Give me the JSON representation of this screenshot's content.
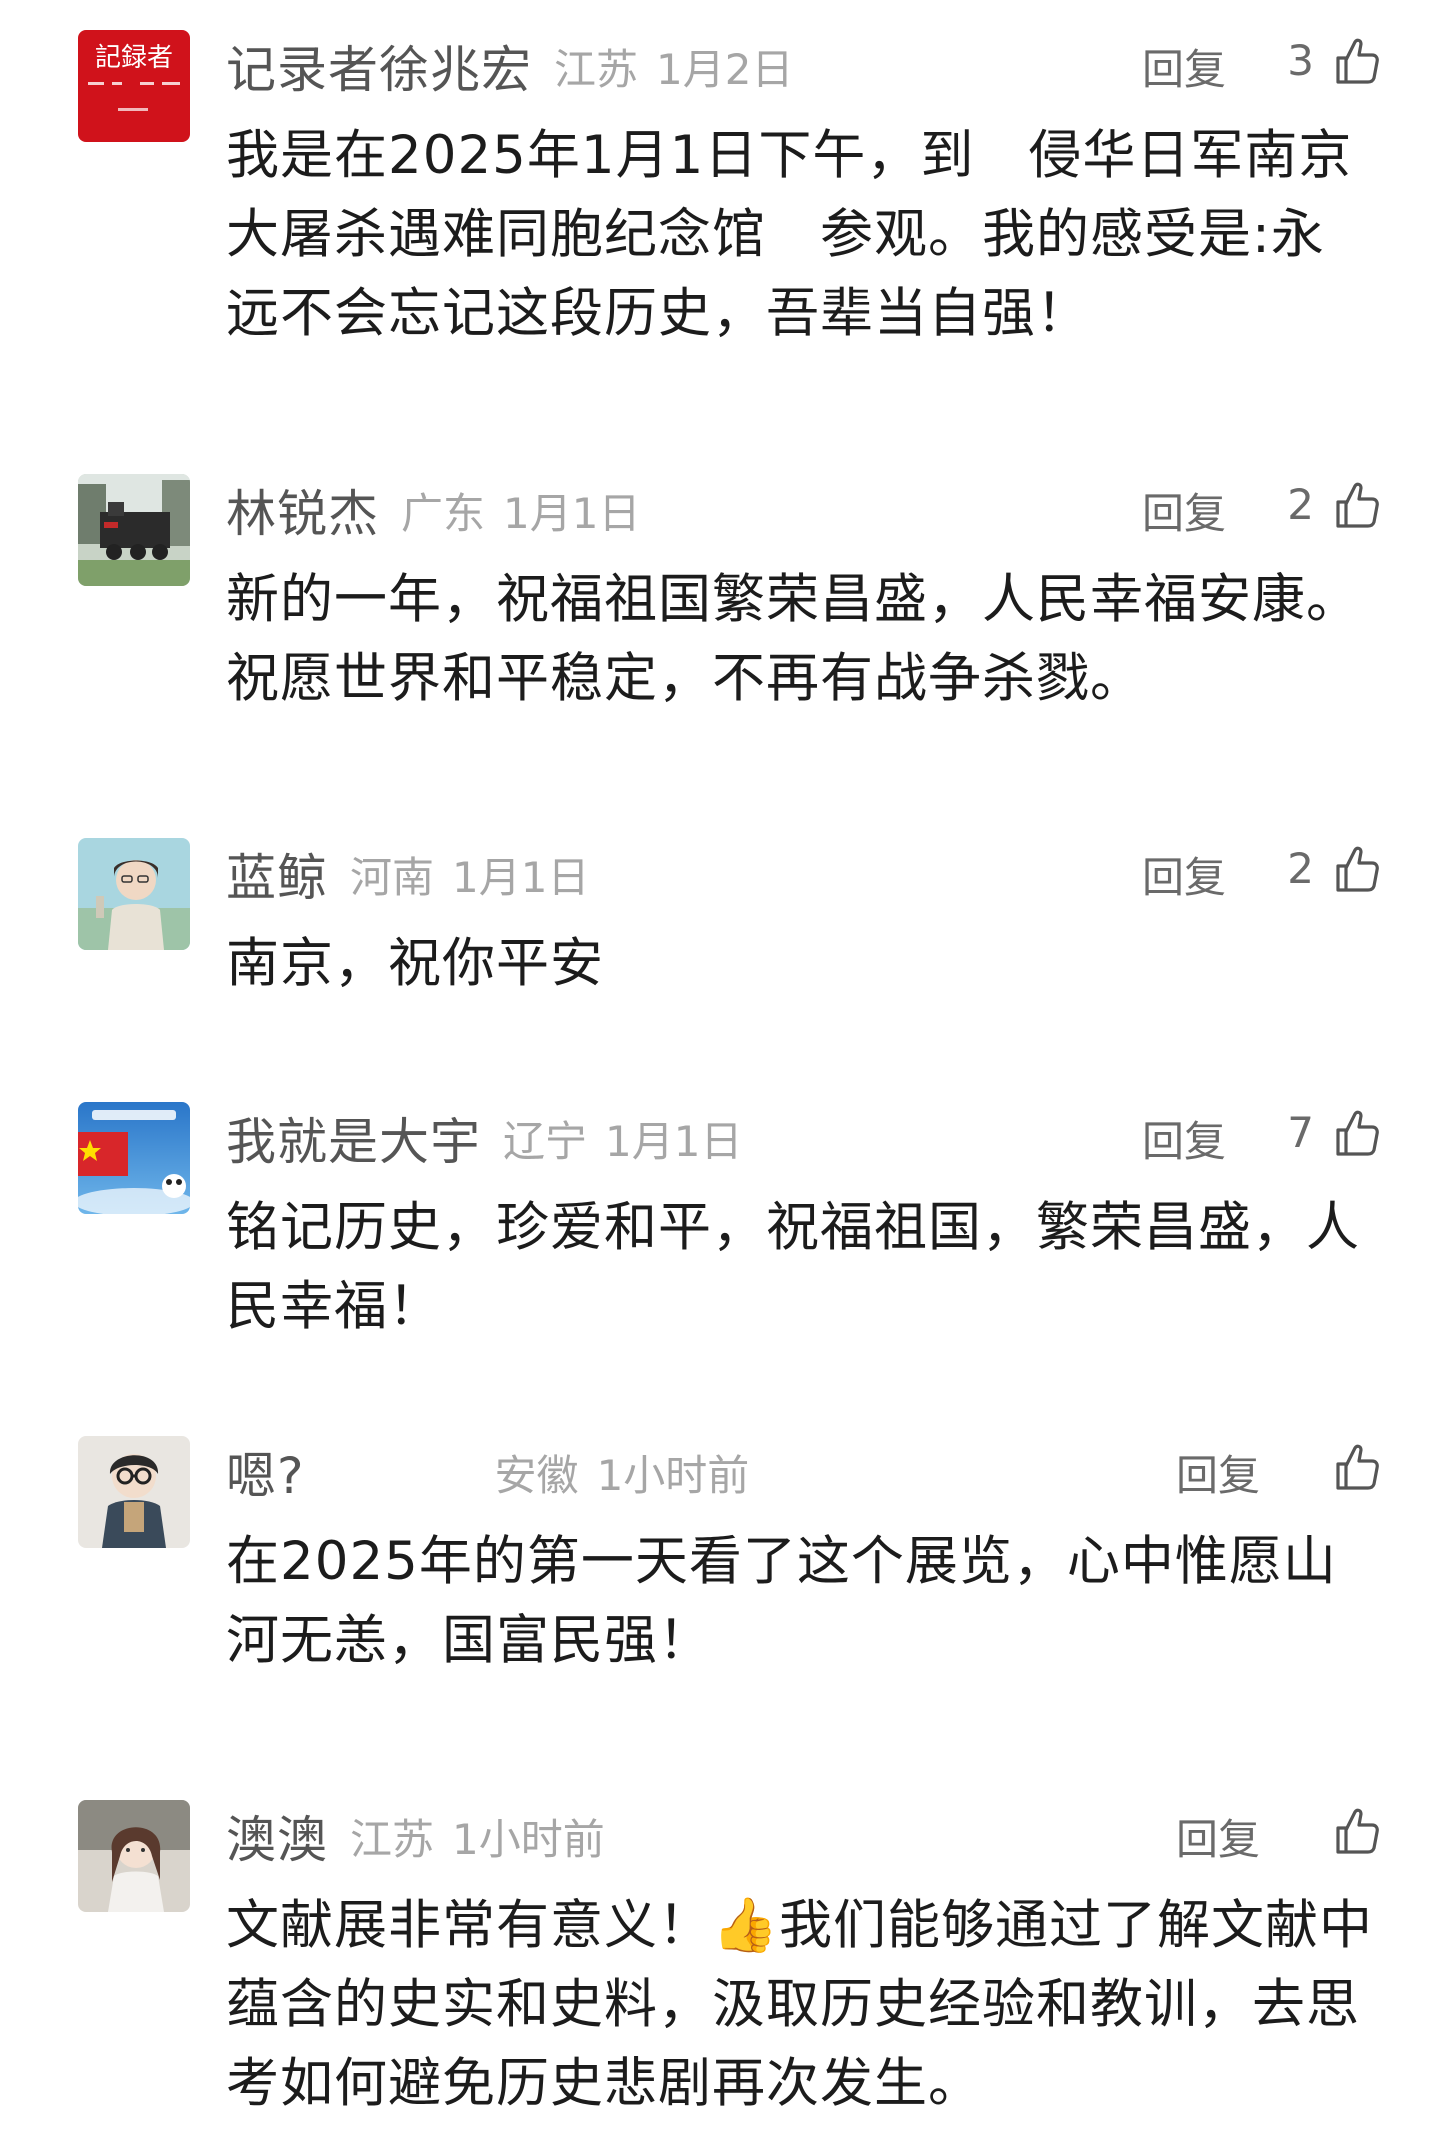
{
  "comments": [
    {
      "name": "记录者徐兆宏",
      "region": "江苏",
      "date": "1月2日",
      "reply_label": "回复",
      "likes": "3",
      "text": "我是在2025年1月1日下午，到　侵华日军南京大屠杀遇难同胞纪念馆　参观。我的感受是:永远不会忘记这段历史，吾辈当自强！",
      "avatar_text": "記録者"
    },
    {
      "name": "林锐杰",
      "region": "广东",
      "date": "1月1日",
      "reply_label": "回复",
      "likes": "2",
      "text": "新的一年，祝福祖国繁荣昌盛，人民幸福安康。祝愿世界和平稳定，不再有战争杀戮。"
    },
    {
      "name": "蓝鲸",
      "region": "河南",
      "date": "1月1日",
      "reply_label": "回复",
      "likes": "2",
      "text": "南京，祝你平安"
    },
    {
      "name": "我就是大宇",
      "region": "辽宁",
      "date": "1月1日",
      "reply_label": "回复",
      "likes": "7",
      "text": "铭记历史，珍爱和平，祝福祖国，繁荣昌盛，人民幸福！"
    },
    {
      "name": "嗯?",
      "region": "安徽",
      "date": "1小时前",
      "reply_label": "回复",
      "likes": "",
      "text": "在2025年的第一天看了这个展览，心中惟愿山河无恙，国富民强！"
    },
    {
      "name": "澳澳",
      "region": "江苏",
      "date": "1小时前",
      "reply_label": "回复",
      "likes": "",
      "text": "文献展非常有意义！👍我们能够通过了解文献中蕴含的史实和史料，汲取历史经验和教训，去思考如何避免历史悲剧再次发生。"
    }
  ],
  "colors": {
    "name": "#555555",
    "meta": "#a6a6a6",
    "text": "#1c1c1c",
    "avatar_red": "#d0121b"
  },
  "icons": {
    "like": "thumbs-up-icon"
  }
}
